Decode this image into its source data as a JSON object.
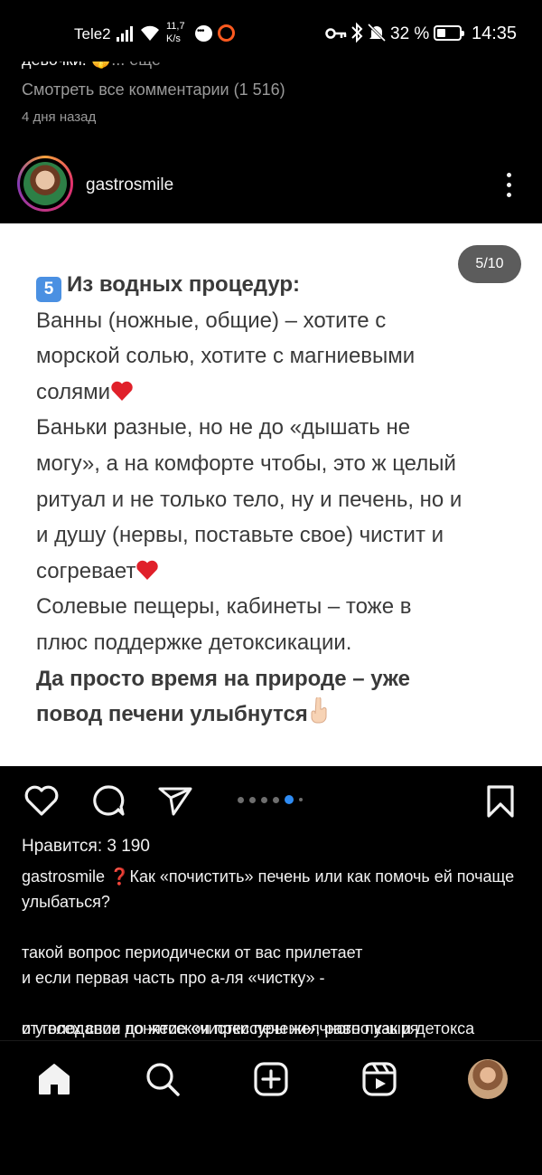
{
  "status_bar": {
    "carrier": "Tele2",
    "net_speed_value": "11,7",
    "net_speed_unit": "K/s",
    "battery_percent": "32 %",
    "time": "14:35"
  },
  "previous_post": {
    "caption_tail": "девочки! 🤫",
    "caption_more": "... еще",
    "view_comments": "Смотреть все комментарии (1 516)",
    "time_ago": "4 дня назад"
  },
  "post": {
    "username": "gastrosmile",
    "slide_counter": "5/10",
    "slide_index": 5,
    "slide_total": 10,
    "slide": {
      "keycap": "5",
      "heading": "Из водных процедур:",
      "lines": [
        "Ванны (ножные, общие) – хотите с",
        "морской солью, хотите с магниевыми",
        "солями",
        "Баньки разные, но не до «дышать не",
        "могу», а на комфорте чтобы, это ж целый",
        "ритуал и не только тело, ну и печень, но и",
        "и душу (нервы, поставьте свое) чистит и",
        "согревает",
        "Солевые пещеры, кабинеты – тоже в",
        "плюс поддержке детоксикации."
      ],
      "bold_lines": [
        "Да просто время на природе – уже",
        "повод печени улыбнутся"
      ]
    },
    "likes": "Нравится: 3 190",
    "caption_username": "gastrosmile",
    "caption_first": "❓Как «почистить» печень или как помочь ей почаще улыбаться?",
    "caption_p2_l1": "такой вопрос периодически от вас прилетает",
    "caption_p2_l2": "и если первая часть про а-ля «чистку» -",
    "caption_p3": "и у всех свое понятие «чистки печени», равно как и детокса",
    "caption_p4_cut": "от голоданий до жесской прессуры желчного пузыря"
  },
  "icons": {
    "like": "heart-icon",
    "comment": "comment-icon",
    "share": "send-icon",
    "save": "bookmark-icon",
    "home": "home-icon",
    "search": "search-icon",
    "create": "plus-square-icon",
    "reels": "reels-icon"
  },
  "colors": {
    "background": "#000000",
    "text": "#f2f2f2",
    "muted": "#9a9a9a",
    "slide_bg": "#ffffff",
    "slide_text": "#3a3a3a",
    "active_dot": "#2f8cf3",
    "heart_red": "#e0202a",
    "keycap_blue": "#4a90e2"
  }
}
